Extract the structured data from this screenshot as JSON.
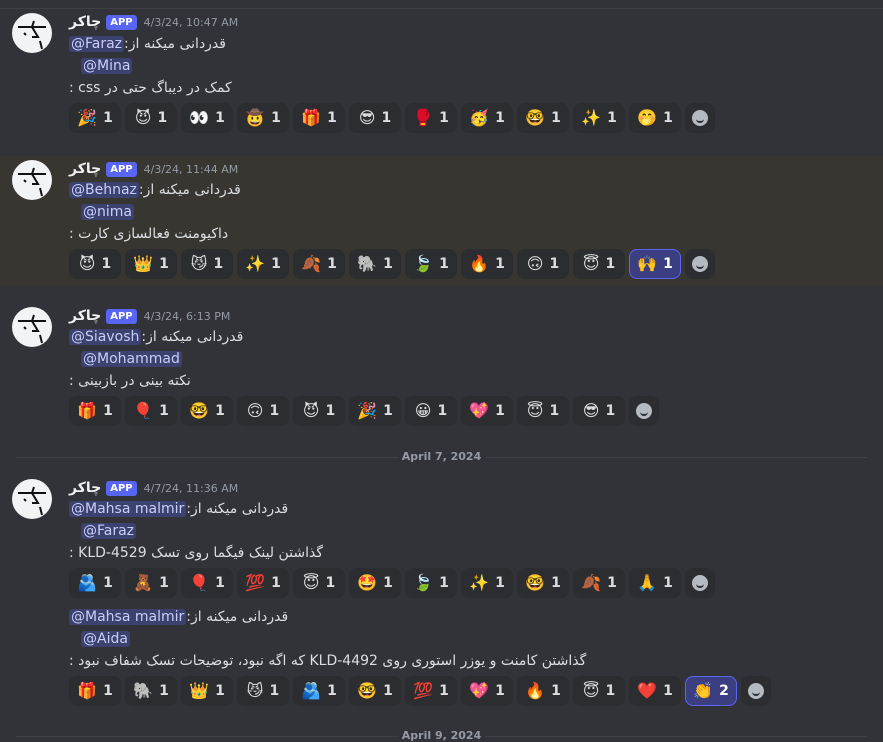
{
  "author": {
    "name": "چاکر",
    "tag": "APP"
  },
  "thanks_label": "قدردانی میکنه از:",
  "messages": [
    {
      "timestamp": "4/3/24, 10:47 AM",
      "from_user": "@Faraz",
      "to_user": "@Mina",
      "reason": "کمک در دیباگ حتی در css :",
      "reactions": [
        {
          "emoji": "🎉",
          "count": "1"
        },
        {
          "emoji": "😈",
          "count": "1"
        },
        {
          "emoji": "👀",
          "count": "1"
        },
        {
          "emoji": "🤠",
          "count": "1"
        },
        {
          "emoji": "🎁",
          "count": "1"
        },
        {
          "emoji": "😎",
          "count": "1"
        },
        {
          "emoji": "🥊",
          "count": "1"
        },
        {
          "emoji": "🥳",
          "count": "1"
        },
        {
          "emoji": "🤓",
          "count": "1"
        },
        {
          "emoji": "✨",
          "count": "1"
        },
        {
          "emoji": "🤭",
          "count": "1"
        }
      ]
    },
    {
      "timestamp": "4/3/24, 11:44 AM",
      "from_user": "@Behnaz",
      "to_user": "@nima",
      "reason": "داکیومنت فعالسازی کارت :",
      "reactions": [
        {
          "emoji": "😈",
          "count": "1"
        },
        {
          "emoji": "👑",
          "count": "1"
        },
        {
          "emoji": "😼",
          "count": "1"
        },
        {
          "emoji": "✨",
          "count": "1"
        },
        {
          "emoji": "🍂",
          "count": "1"
        },
        {
          "emoji": "🐘",
          "count": "1"
        },
        {
          "emoji": "🍃",
          "count": "1"
        },
        {
          "emoji": "🔥",
          "count": "1"
        },
        {
          "emoji": "🙃",
          "count": "1"
        },
        {
          "emoji": "😇",
          "count": "1"
        },
        {
          "emoji": "🙌",
          "count": "1",
          "me": true
        }
      ]
    },
    {
      "timestamp": "4/3/24, 6:13 PM",
      "from_user": "@Siavosh",
      "to_user": "@Mohammad",
      "reason": "نکته بینی در بازبینی :",
      "reactions": [
        {
          "emoji": "🎁",
          "count": "1"
        },
        {
          "emoji": "🎈",
          "count": "1"
        },
        {
          "emoji": "🤓",
          "count": "1"
        },
        {
          "emoji": "🙃",
          "count": "1"
        },
        {
          "emoji": "😈",
          "count": "1"
        },
        {
          "emoji": "🎉",
          "count": "1"
        },
        {
          "emoji": "😀",
          "count": "1"
        },
        {
          "emoji": "💖",
          "count": "1"
        },
        {
          "emoji": "😇",
          "count": "1"
        },
        {
          "emoji": "😎",
          "count": "1"
        }
      ]
    },
    {
      "timestamp": "4/7/24, 11:36 AM",
      "from_user": "@Mahsa malmir",
      "to_user": "@Faraz",
      "reason": "گذاشتن لینک فیگما روی تسک KLD-4529 :",
      "reactions": [
        {
          "emoji": "🫂",
          "count": "1"
        },
        {
          "emoji": "🧸",
          "count": "1"
        },
        {
          "emoji": "🎈",
          "count": "1"
        },
        {
          "emoji": "💯",
          "count": "1"
        },
        {
          "emoji": "😇",
          "count": "1"
        },
        {
          "emoji": "🤩",
          "count": "1"
        },
        {
          "emoji": "🍃",
          "count": "1"
        },
        {
          "emoji": "✨",
          "count": "1"
        },
        {
          "emoji": "🤓",
          "count": "1"
        },
        {
          "emoji": "🍂",
          "count": "1"
        },
        {
          "emoji": "🙏",
          "count": "1"
        }
      ]
    },
    {
      "timestamp": "",
      "from_user": "@Mahsa malmir",
      "to_user": "@Aida",
      "reason": "گذاشتن کامنت و یوزر استوری روی KLD-4492 که اگه نبود، توضیحات تسک شفاف نبود :",
      "reactions": [
        {
          "emoji": "🎁",
          "count": "1"
        },
        {
          "emoji": "🐘",
          "count": "1"
        },
        {
          "emoji": "👑",
          "count": "1"
        },
        {
          "emoji": "😼",
          "count": "1"
        },
        {
          "emoji": "🫂",
          "count": "1"
        },
        {
          "emoji": "🤓",
          "count": "1"
        },
        {
          "emoji": "💯",
          "count": "1"
        },
        {
          "emoji": "💖",
          "count": "1"
        },
        {
          "emoji": "🔥",
          "count": "1"
        },
        {
          "emoji": "😇",
          "count": "1"
        },
        {
          "emoji": "❤️",
          "count": "1"
        },
        {
          "emoji": "👏",
          "count": "2",
          "me": true
        }
      ]
    }
  ],
  "dividers": [
    {
      "label": "April 7, 2024"
    },
    {
      "label": "April 9, 2024"
    }
  ]
}
